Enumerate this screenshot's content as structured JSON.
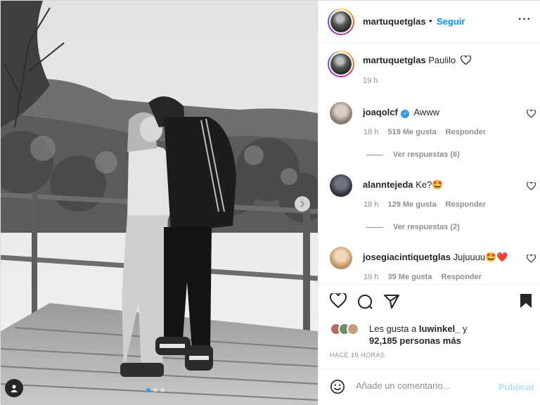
{
  "post": {
    "author": "martuquetglas",
    "separator": "•",
    "follow_label": "Seguir",
    "more_icon": "more-horizontal-icon",
    "caption": "Paulilo",
    "caption_time": "19 h",
    "carousel": {
      "slides": 3,
      "active_index": 0
    }
  },
  "comments": [
    {
      "user": "joaqolcf",
      "verified": true,
      "text": "Awww",
      "time": "18 h",
      "likes": "519 Me gusta",
      "reply_label": "Responder",
      "view_replies": "Ver respuestas (6)",
      "avatar_color": "#9a8f86"
    },
    {
      "user": "alanntejeda",
      "verified": false,
      "text": "Ke?🤩",
      "time": "18 h",
      "likes": "129 Me gusta",
      "reply_label": "Responder",
      "view_replies": "Ver respuestas (2)",
      "avatar_color": "#3a3d48"
    },
    {
      "user": "josegiacintiquetglas",
      "verified": false,
      "text": "Jujuuuu🤩❤️",
      "time": "19 h",
      "likes": "35 Me gusta",
      "reply_label": "Responder",
      "view_replies": "",
      "avatar_color": "#c49a6c"
    }
  ],
  "likes": {
    "prefix": "Les gusta a",
    "user": "luwinkel_",
    "connector": "y",
    "others": "92,185 personas más"
  },
  "post_time": "HACE 19 HORAS",
  "add_comment": {
    "placeholder": "Añade un comentario...",
    "publish_label": "Publicar"
  },
  "colors": {
    "link": "#0095f6",
    "verified": "#3897f0",
    "publish_disabled": "#b2dffc",
    "meta": "#8e8e8e",
    "carousel_active_dot": "#2a9df4"
  }
}
